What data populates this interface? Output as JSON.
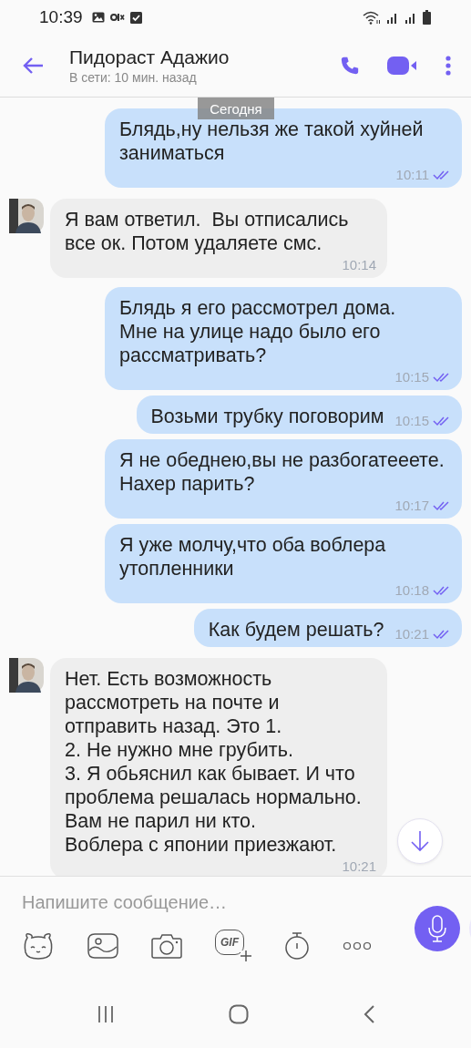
{
  "status_bar": {
    "time": "10:39"
  },
  "header": {
    "name": "Пидораст Адажио",
    "status": "В сети: 10 мин. назад"
  },
  "date_badge": "Сегодня",
  "messages": [
    {
      "kind": "out",
      "text": "Блядь,ну нельзя же такой хуйней заниматься",
      "time": "10:11",
      "read": true
    },
    {
      "kind": "in",
      "text": "Я вам ответил.  Вы отписались все ок. Потом удаляете смс.",
      "time": "10:14"
    },
    {
      "kind": "out",
      "text": "Блядь я его рассмотрел дома.\nМне на улице надо было его рассматривать?",
      "time": "10:15",
      "read": true
    },
    {
      "kind": "out",
      "text": "Возьми трубку поговорим",
      "time": "10:15",
      "read": true
    },
    {
      "kind": "out",
      "text": "Я не обеднею,вы не разбогатееете. Нахер парить?",
      "time": "10:17",
      "read": true
    },
    {
      "kind": "out",
      "text": "Я уже молчу,что оба воблера утопленники",
      "time": "10:18",
      "read": true
    },
    {
      "kind": "out",
      "text": "Как будем решать?",
      "time": "10:21",
      "read": true
    },
    {
      "kind": "in",
      "text": "Нет. Есть возможность рассмотреть на почте и отправить назад. Это 1.\n2. Не нужно мне грубить.\n3. Я обьяснил как бывает. И что проблема решалась нормально.\nВам не парил ни кто.\nВоблера с японии приезжают.",
      "time": "10:21"
    }
  ],
  "composer": {
    "placeholder": "Напишите сообщение…",
    "gif_label": "GIF"
  }
}
